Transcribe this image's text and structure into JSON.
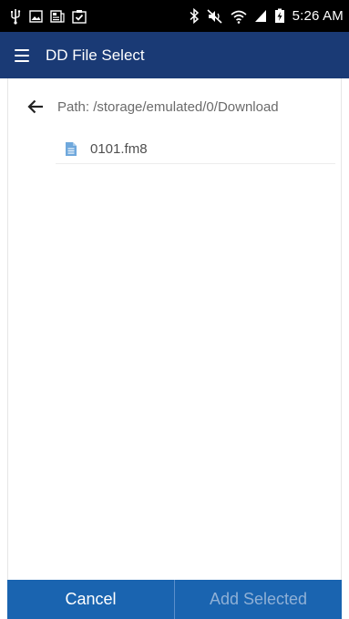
{
  "status_bar": {
    "time": "5:26 AM",
    "left_icons": [
      "usb-icon",
      "gallery-icon",
      "news-icon",
      "clipboard-check-icon"
    ],
    "right_icons": [
      "bluetooth-icon",
      "mute-icon",
      "wifi-icon",
      "signal-icon",
      "battery-charging-icon"
    ]
  },
  "app_bar": {
    "title": "DD File Select",
    "menu_icon": "hamburger-menu-icon",
    "background": "#1a3a75"
  },
  "path": {
    "label": "Path: /storage/emulated/0/Download",
    "back_icon": "arrow-back-icon"
  },
  "files": [
    {
      "name": "0101.fm8",
      "icon": "document-icon"
    }
  ],
  "buttons": {
    "cancel": "Cancel",
    "add_selected": "Add Selected",
    "background": "#1a64b0"
  }
}
